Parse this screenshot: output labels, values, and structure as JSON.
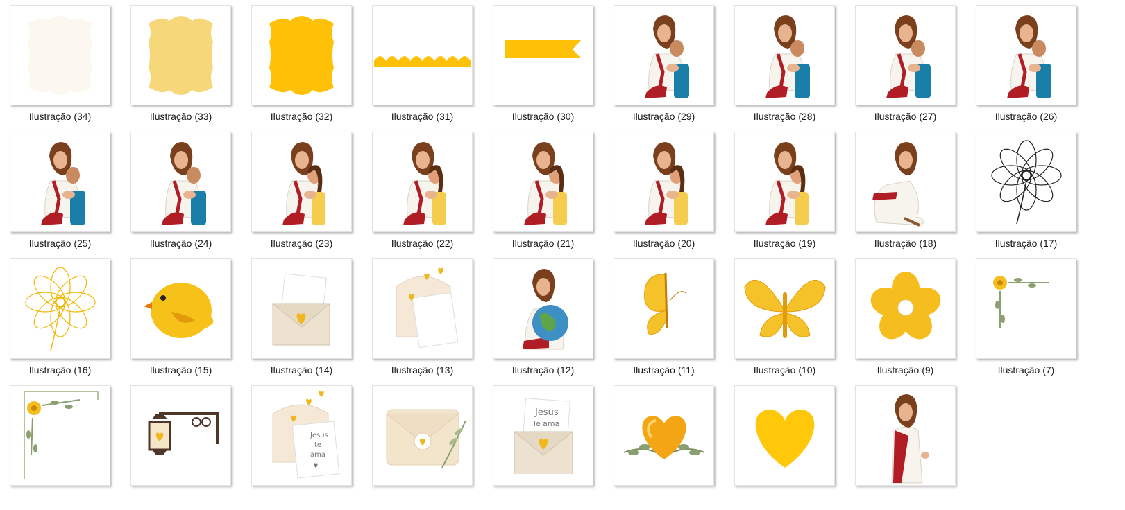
{
  "items": [
    {
      "label": "Ilustração (34)",
      "icon": "frame-cream-icon"
    },
    {
      "label": "Ilustração (33)",
      "icon": "frame-lightyellow-icon"
    },
    {
      "label": "Ilustração (32)",
      "icon": "frame-yellow-icon"
    },
    {
      "label": "Ilustração (31)",
      "icon": "scallop-border-icon"
    },
    {
      "label": "Ilustração (30)",
      "icon": "ribbon-banner-icon"
    },
    {
      "label": "Ilustração (29)",
      "icon": "jesus-hug-boy-icon"
    },
    {
      "label": "Ilustração (28)",
      "icon": "jesus-hug-boy-icon"
    },
    {
      "label": "Ilustração (27)",
      "icon": "jesus-hug-boy-icon"
    },
    {
      "label": "Ilustração (26)",
      "icon": "jesus-hug-boy-icon"
    },
    {
      "label": "Ilustração (25)",
      "icon": "jesus-hug-boy-icon"
    },
    {
      "label": "Ilustração (24)",
      "icon": "jesus-hug-boy-icon"
    },
    {
      "label": "Ilustração (23)",
      "icon": "jesus-hug-girl-icon"
    },
    {
      "label": "Ilustração (22)",
      "icon": "jesus-hug-girl-icon"
    },
    {
      "label": "Ilustração (21)",
      "icon": "jesus-hug-girl-icon"
    },
    {
      "label": "Ilustração (20)",
      "icon": "jesus-hug-girl-icon"
    },
    {
      "label": "Ilustração (19)",
      "icon": "jesus-hug-girl-icon"
    },
    {
      "label": "Ilustração (18)",
      "icon": "jesus-kneeling-icon"
    },
    {
      "label": "Ilustração (17)",
      "icon": "flower-outline-black-icon"
    },
    {
      "label": "Ilustração (16)",
      "icon": "flower-outline-yellow-icon"
    },
    {
      "label": "Ilustração (15)",
      "icon": "yellow-bird-icon"
    },
    {
      "label": "Ilustração (14)",
      "icon": "envelope-heart-icon"
    },
    {
      "label": "Ilustração (13)",
      "icon": "envelope-hearts-icon"
    },
    {
      "label": "Ilustração (12)",
      "icon": "jesus-globe-icon"
    },
    {
      "label": "Ilustração (11)",
      "icon": "butterfly-side-icon"
    },
    {
      "label": "Ilustração (10)",
      "icon": "butterfly-icon"
    },
    {
      "label": "Ilustração (9)",
      "icon": "yellow-flower-icon"
    },
    {
      "label": "Ilustração (7)",
      "icon": "corner-flower-small-icon"
    },
    {
      "label": "",
      "icon": "corner-flower-frame-icon"
    },
    {
      "label": "",
      "icon": "lantern-icon"
    },
    {
      "label": "",
      "icon": "envelope-note-icon"
    },
    {
      "label": "",
      "icon": "closed-envelope-icon"
    },
    {
      "label": "",
      "icon": "envelope-jesus-te-ama-icon"
    },
    {
      "label": "",
      "icon": "heart-leaves-icon"
    },
    {
      "label": "",
      "icon": "yellow-heart-icon"
    },
    {
      "label": "",
      "icon": "jesus-standing-icon"
    }
  ],
  "note_text": {
    "line1": "Jesus",
    "line2": "te",
    "line3": "ama",
    "env_line1": "Jesus",
    "env_line2": "Te ama"
  },
  "colors": {
    "yellow": "#ffc107",
    "light_yellow": "#f6d87a",
    "cream": "#fdf8ef",
    "red": "#b01d24",
    "blue": "#1a7fa8"
  }
}
